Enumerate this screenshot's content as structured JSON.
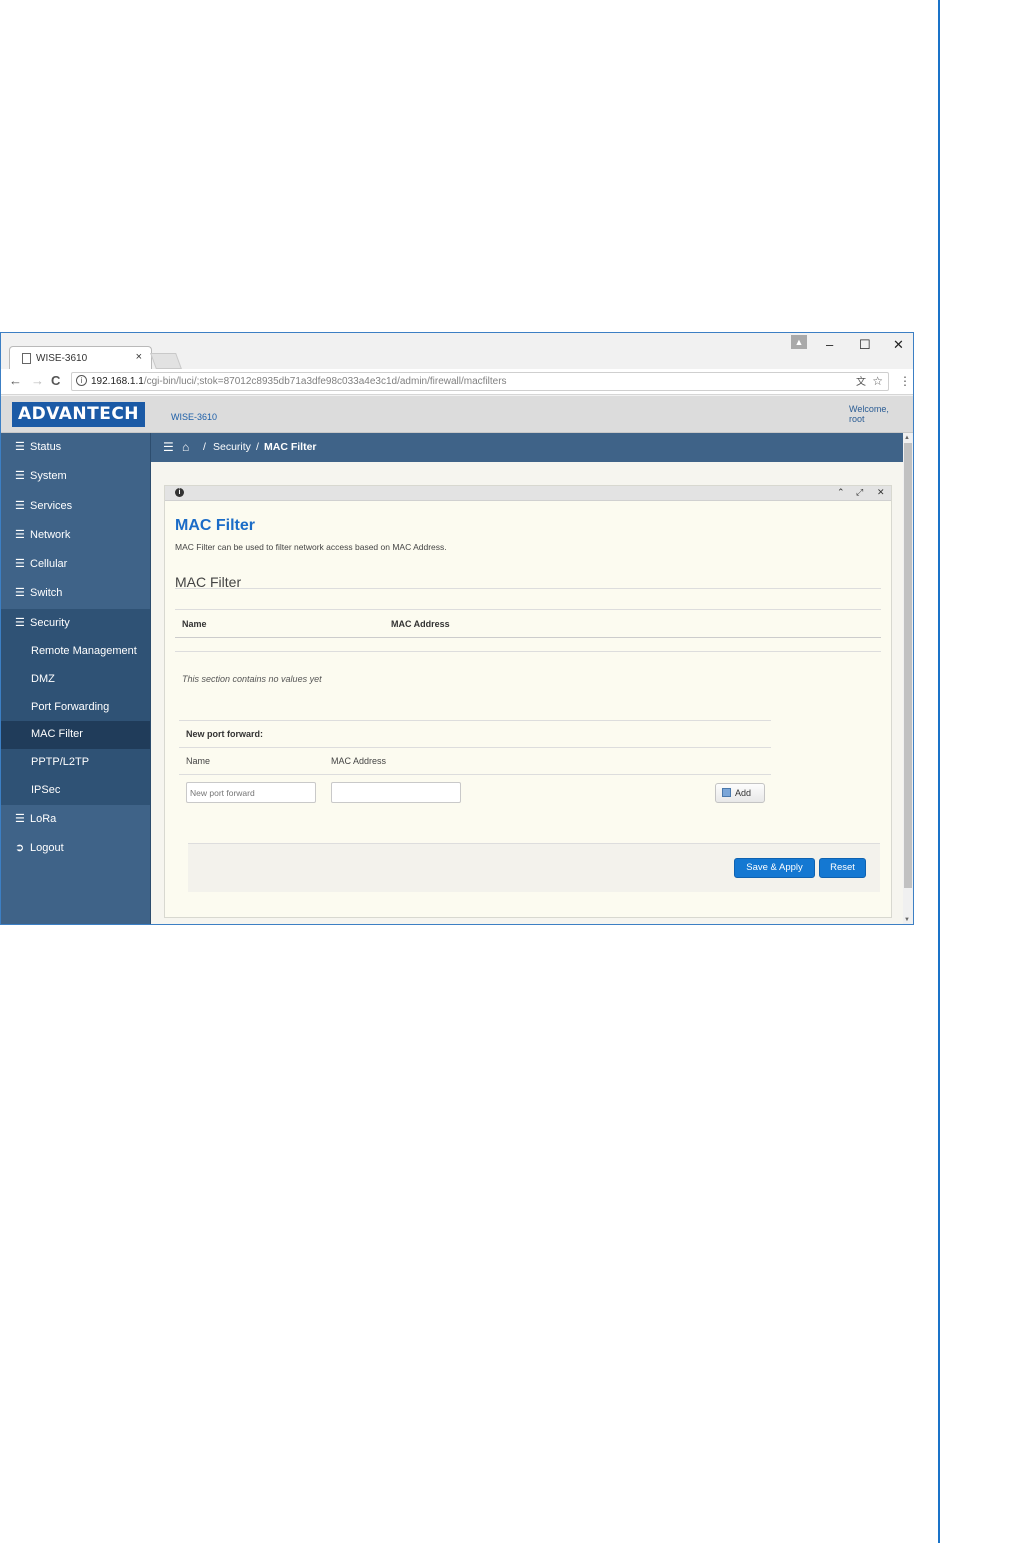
{
  "browser": {
    "tab_title": "WISE-3610",
    "tab_close": "×",
    "url_host": "192.168.1.1",
    "url_path": "/cgi-bin/luci/;stok=87012c8935db71a3dfe98c033a4e3c1d/admin/firewall/macfilters",
    "window_controls": {
      "minimize": "–",
      "maximize": "☐",
      "close": "✕"
    },
    "nav": {
      "back": "←",
      "forward": "→",
      "reload": "C"
    },
    "icons": [
      "doc-icon",
      "info-icon",
      "translate-icon",
      "star-icon",
      "menu-icon",
      "profile-icon"
    ]
  },
  "header": {
    "logo": "ADVANTECH",
    "device": "WISE-3610",
    "welcome": "Welcome, root"
  },
  "sidebar": {
    "items": [
      {
        "label": "Status"
      },
      {
        "label": "System"
      },
      {
        "label": "Services"
      },
      {
        "label": "Network"
      },
      {
        "label": "Cellular"
      },
      {
        "label": "Switch"
      },
      {
        "label": "Security"
      }
    ],
    "security_sub": [
      {
        "label": "Remote Management"
      },
      {
        "label": "DMZ"
      },
      {
        "label": "Port Forwarding"
      },
      {
        "label": "MAC Filter"
      },
      {
        "label": "PPTP/L2TP"
      },
      {
        "label": "IPSec"
      }
    ],
    "bottom_items": [
      {
        "label": "LoRa"
      },
      {
        "label": "Logout"
      }
    ]
  },
  "breadcrumb": {
    "sep": "/",
    "crumbs": [
      "Security",
      "MAC Filter"
    ]
  },
  "page": {
    "title": "MAC Filter",
    "description": "MAC Filter can be used to filter network access based on MAC Address.",
    "section_title": "MAC Filter",
    "table_headers": [
      "Name",
      "MAC Address"
    ],
    "empty_note": "This section contains no values yet",
    "new_entry_label": "New port forward:",
    "new_columns": [
      "Name",
      "MAC Address"
    ],
    "name_placeholder": "New port forward",
    "mac_value": "",
    "add_label": "Add",
    "save_label": "Save & Apply",
    "reset_label": "Reset"
  },
  "colors": {
    "accent": "#1b6cc7",
    "sidebar_bg": "#3f6388",
    "button_blue": "#1478d2"
  }
}
